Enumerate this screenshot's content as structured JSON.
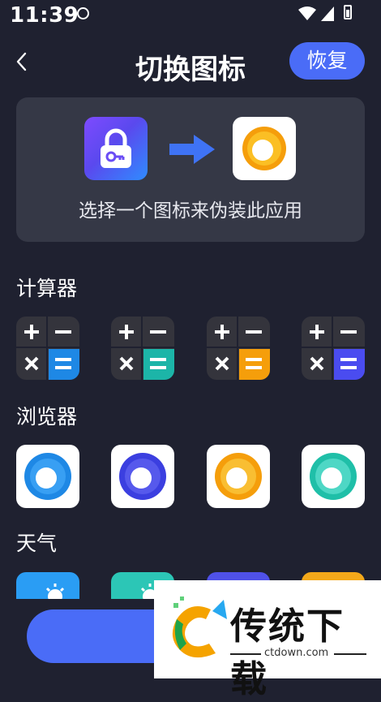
{
  "status_bar": {
    "time": "11:39"
  },
  "header": {
    "title": "切换图标",
    "restore_label": "恢复"
  },
  "preview": {
    "description": "选择一个图标来伪装此应用"
  },
  "sections": {
    "calculator": "计算器",
    "browser": "浏览器",
    "weather": "天气"
  },
  "calculator_icons": [
    {
      "accent": "#1e88e5"
    },
    {
      "accent": "#1cb5a8"
    },
    {
      "accent": "#f59e0b"
    },
    {
      "accent": "#4a4cf0"
    }
  ],
  "browser_icons": [
    {
      "ring": "#1e88e5"
    },
    {
      "ring": "#3b3fe0"
    },
    {
      "ring": "#f59e0b"
    },
    {
      "ring": "#1fbfa8"
    }
  ],
  "weather_icons": [
    {
      "bg": "#2a9df4"
    },
    {
      "bg": "#2cc6b6"
    },
    {
      "bg": "#4f51e8"
    },
    {
      "bg": "#f3a81a"
    }
  ],
  "watermark": {
    "brand": "传统下载",
    "url": "ctdown.com"
  }
}
